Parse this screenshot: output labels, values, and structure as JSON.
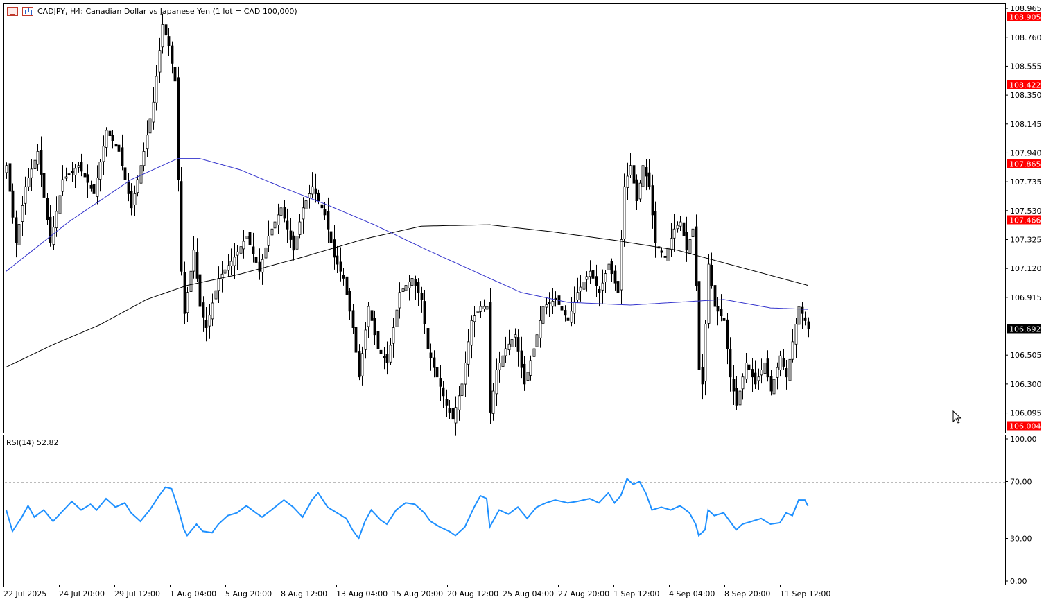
{
  "header": {
    "title": "CADJPY, H4:  Canadian Dollar vs Japanese Yen (1 lot = CAD 100,000)",
    "icons": [
      "list-icon",
      "chart-window-icon"
    ]
  },
  "rsi": {
    "label": "RSI(14) 52.82",
    "levels": [
      70,
      30
    ],
    "ticks": [
      "100.00",
      "70.00",
      "30.00",
      "0.00"
    ]
  },
  "colors": {
    "background": "#ffffff",
    "bull_candle": "#ffffff",
    "bear_candle": "#000000",
    "ma_fast": "#3333cc",
    "ma_slow": "#000000",
    "level_lines": "#ff0000",
    "current_price_line": "#000000",
    "rsi_line": "#1e90ff"
  },
  "chart_data": [
    {
      "type": "candlestick",
      "symbol": "CADJPY",
      "timeframe": "H4",
      "x_ticks": [
        "22 Jul 2025",
        "24 Jul 20:00",
        "29 Jul 12:00",
        "1 Aug 04:00",
        "5 Aug 20:00",
        "8 Aug 12:00",
        "13 Aug 04:00",
        "15 Aug 20:00",
        "20 Aug 12:00",
        "25 Aug 04:00",
        "27 Aug 20:00",
        "1 Sep 12:00",
        "4 Sep 04:00",
        "8 Sep 20:00",
        "11 Sep 12:00"
      ],
      "y_ticks": [
        "108.965",
        "108.760",
        "108.555",
        "108.350",
        "108.145",
        "107.940",
        "107.735",
        "107.530",
        "107.325",
        "107.120",
        "106.915",
        "106.505",
        "106.300",
        "106.095"
      ],
      "ylim": [
        105.96,
        108.99
      ],
      "horizontal_levels": [
        {
          "value": 108.905,
          "label": "108.905"
        },
        {
          "value": 108.422,
          "label": "108.422"
        },
        {
          "value": 107.865,
          "label": "107.865"
        },
        {
          "value": 107.466,
          "label": "107.466"
        },
        {
          "value": 106.004,
          "label": "106.004"
        }
      ],
      "current_price": {
        "value": 106.692,
        "label": "106.692"
      },
      "close_path": [
        {
          "i": 0,
          "v": 107.85
        },
        {
          "i": 3,
          "v": 107.3
        },
        {
          "i": 6,
          "v": 107.7
        },
        {
          "i": 10,
          "v": 107.95
        },
        {
          "i": 14,
          "v": 107.3
        },
        {
          "i": 18,
          "v": 107.75
        },
        {
          "i": 23,
          "v": 107.85
        },
        {
          "i": 28,
          "v": 107.65
        },
        {
          "i": 32,
          "v": 108.1
        },
        {
          "i": 36,
          "v": 107.95
        },
        {
          "i": 40,
          "v": 107.55
        },
        {
          "i": 44,
          "v": 107.95
        },
        {
          "i": 47,
          "v": 108.3
        },
        {
          "i": 50,
          "v": 108.85
        },
        {
          "i": 52,
          "v": 108.7
        },
        {
          "i": 54,
          "v": 108.45
        },
        {
          "i": 55,
          "v": 107.75
        },
        {
          "i": 56,
          "v": 107.1
        },
        {
          "i": 57,
          "v": 106.8
        },
        {
          "i": 60,
          "v": 107.25
        },
        {
          "i": 62,
          "v": 106.85
        },
        {
          "i": 64,
          "v": 106.7
        },
        {
          "i": 68,
          "v": 107.05
        },
        {
          "i": 73,
          "v": 107.2
        },
        {
          "i": 77,
          "v": 107.35
        },
        {
          "i": 81,
          "v": 107.1
        },
        {
          "i": 84,
          "v": 107.35
        },
        {
          "i": 88,
          "v": 107.55
        },
        {
          "i": 92,
          "v": 107.25
        },
        {
          "i": 95,
          "v": 107.55
        },
        {
          "i": 98,
          "v": 107.7
        },
        {
          "i": 102,
          "v": 107.5
        },
        {
          "i": 105,
          "v": 107.2
        },
        {
          "i": 108,
          "v": 107.05
        },
        {
          "i": 111,
          "v": 106.7
        },
        {
          "i": 113,
          "v": 106.35
        },
        {
          "i": 116,
          "v": 106.85
        },
        {
          "i": 119,
          "v": 106.55
        },
        {
          "i": 122,
          "v": 106.45
        },
        {
          "i": 126,
          "v": 106.95
        },
        {
          "i": 130,
          "v": 107.05
        },
        {
          "i": 133,
          "v": 106.9
        },
        {
          "i": 135,
          "v": 106.55
        },
        {
          "i": 138,
          "v": 106.35
        },
        {
          "i": 141,
          "v": 106.15
        },
        {
          "i": 143,
          "v": 106.05
        },
        {
          "i": 146,
          "v": 106.3
        },
        {
          "i": 149,
          "v": 106.75
        },
        {
          "i": 152,
          "v": 106.85
        },
        {
          "i": 154,
          "v": 106.85
        },
        {
          "i": 155,
          "v": 106.1
        },
        {
          "i": 157,
          "v": 106.4
        },
        {
          "i": 160,
          "v": 106.55
        },
        {
          "i": 163,
          "v": 106.65
        },
        {
          "i": 166,
          "v": 106.3
        },
        {
          "i": 169,
          "v": 106.55
        },
        {
          "i": 172,
          "v": 106.85
        },
        {
          "i": 176,
          "v": 106.9
        },
        {
          "i": 180,
          "v": 106.75
        },
        {
          "i": 183,
          "v": 106.95
        },
        {
          "i": 187,
          "v": 107.1
        },
        {
          "i": 190,
          "v": 106.95
        },
        {
          "i": 193,
          "v": 107.15
        },
        {
          "i": 196,
          "v": 106.95
        },
        {
          "i": 198,
          "v": 107.7
        },
        {
          "i": 200,
          "v": 107.85
        },
        {
          "i": 202,
          "v": 107.6
        },
        {
          "i": 204,
          "v": 107.85
        },
        {
          "i": 206,
          "v": 107.7
        },
        {
          "i": 208,
          "v": 107.3
        },
        {
          "i": 211,
          "v": 107.2
        },
        {
          "i": 214,
          "v": 107.4
        },
        {
          "i": 216,
          "v": 107.45
        },
        {
          "i": 218,
          "v": 107.25
        },
        {
          "i": 220,
          "v": 107.4
        },
        {
          "i": 221,
          "v": 107.0
        },
        {
          "i": 222,
          "v": 106.4
        },
        {
          "i": 223,
          "v": 106.3
        },
        {
          "i": 225,
          "v": 107.15
        },
        {
          "i": 227,
          "v": 106.85
        },
        {
          "i": 230,
          "v": 106.75
        },
        {
          "i": 232,
          "v": 106.35
        },
        {
          "i": 234,
          "v": 106.15
        },
        {
          "i": 237,
          "v": 106.45
        },
        {
          "i": 240,
          "v": 106.3
        },
        {
          "i": 243,
          "v": 106.45
        },
        {
          "i": 245,
          "v": 106.25
        },
        {
          "i": 248,
          "v": 106.5
        },
        {
          "i": 250,
          "v": 106.35
        },
        {
          "i": 252,
          "v": 106.6
        },
        {
          "i": 254,
          "v": 106.85
        },
        {
          "i": 256,
          "v": 106.75
        },
        {
          "i": 257,
          "v": 106.69
        }
      ],
      "ma_fast": [
        {
          "i": 0,
          "v": 107.1
        },
        {
          "i": 20,
          "v": 107.45
        },
        {
          "i": 40,
          "v": 107.75
        },
        {
          "i": 55,
          "v": 107.9
        },
        {
          "i": 62,
          "v": 107.9
        },
        {
          "i": 75,
          "v": 107.82
        },
        {
          "i": 88,
          "v": 107.7
        },
        {
          "i": 103,
          "v": 107.57
        },
        {
          "i": 118,
          "v": 107.43
        },
        {
          "i": 135,
          "v": 107.25
        },
        {
          "i": 150,
          "v": 107.1
        },
        {
          "i": 165,
          "v": 106.95
        },
        {
          "i": 180,
          "v": 106.88
        },
        {
          "i": 200,
          "v": 106.86
        },
        {
          "i": 215,
          "v": 106.88
        },
        {
          "i": 230,
          "v": 106.9
        },
        {
          "i": 245,
          "v": 106.84
        },
        {
          "i": 257,
          "v": 106.83
        }
      ],
      "ma_slow": [
        {
          "i": 0,
          "v": 106.42
        },
        {
          "i": 15,
          "v": 106.58
        },
        {
          "i": 30,
          "v": 106.72
        },
        {
          "i": 45,
          "v": 106.9
        },
        {
          "i": 58,
          "v": 107.0
        },
        {
          "i": 75,
          "v": 107.08
        },
        {
          "i": 95,
          "v": 107.2
        },
        {
          "i": 115,
          "v": 107.33
        },
        {
          "i": 133,
          "v": 107.42
        },
        {
          "i": 155,
          "v": 107.43
        },
        {
          "i": 175,
          "v": 107.38
        },
        {
          "i": 195,
          "v": 107.32
        },
        {
          "i": 215,
          "v": 107.25
        },
        {
          "i": 235,
          "v": 107.13
        },
        {
          "i": 257,
          "v": 107.0
        }
      ]
    },
    {
      "type": "line",
      "name": "RSI(14)",
      "ylim": [
        0,
        100
      ],
      "levels": [
        70,
        30
      ],
      "values": [
        {
          "i": 0,
          "v": 50
        },
        {
          "i": 2,
          "v": 35
        },
        {
          "i": 5,
          "v": 45
        },
        {
          "i": 7,
          "v": 53
        },
        {
          "i": 9,
          "v": 45
        },
        {
          "i": 12,
          "v": 50
        },
        {
          "i": 15,
          "v": 42
        },
        {
          "i": 18,
          "v": 49
        },
        {
          "i": 21,
          "v": 56
        },
        {
          "i": 24,
          "v": 50
        },
        {
          "i": 27,
          "v": 54
        },
        {
          "i": 29,
          "v": 50
        },
        {
          "i": 32,
          "v": 58
        },
        {
          "i": 35,
          "v": 52
        },
        {
          "i": 38,
          "v": 55
        },
        {
          "i": 40,
          "v": 48
        },
        {
          "i": 43,
          "v": 42
        },
        {
          "i": 46,
          "v": 50
        },
        {
          "i": 49,
          "v": 60
        },
        {
          "i": 51,
          "v": 66
        },
        {
          "i": 53,
          "v": 65
        },
        {
          "i": 55,
          "v": 52
        },
        {
          "i": 57,
          "v": 36
        },
        {
          "i": 58,
          "v": 32
        },
        {
          "i": 61,
          "v": 40
        },
        {
          "i": 63,
          "v": 35
        },
        {
          "i": 66,
          "v": 34
        },
        {
          "i": 68,
          "v": 40
        },
        {
          "i": 71,
          "v": 46
        },
        {
          "i": 74,
          "v": 48
        },
        {
          "i": 77,
          "v": 53
        },
        {
          "i": 80,
          "v": 48
        },
        {
          "i": 82,
          "v": 45
        },
        {
          "i": 85,
          "v": 50
        },
        {
          "i": 89,
          "v": 57
        },
        {
          "i": 92,
          "v": 52
        },
        {
          "i": 95,
          "v": 45
        },
        {
          "i": 98,
          "v": 57
        },
        {
          "i": 100,
          "v": 62
        },
        {
          "i": 103,
          "v": 52
        },
        {
          "i": 106,
          "v": 48
        },
        {
          "i": 109,
          "v": 44
        },
        {
          "i": 111,
          "v": 36
        },
        {
          "i": 113,
          "v": 30
        },
        {
          "i": 115,
          "v": 42
        },
        {
          "i": 117,
          "v": 50
        },
        {
          "i": 120,
          "v": 43
        },
        {
          "i": 122,
          "v": 40
        },
        {
          "i": 125,
          "v": 50
        },
        {
          "i": 128,
          "v": 55
        },
        {
          "i": 131,
          "v": 54
        },
        {
          "i": 134,
          "v": 48
        },
        {
          "i": 136,
          "v": 42
        },
        {
          "i": 139,
          "v": 38
        },
        {
          "i": 142,
          "v": 35
        },
        {
          "i": 144,
          "v": 32
        },
        {
          "i": 147,
          "v": 38
        },
        {
          "i": 150,
          "v": 52
        },
        {
          "i": 152,
          "v": 60
        },
        {
          "i": 154,
          "v": 58
        },
        {
          "i": 155,
          "v": 38
        },
        {
          "i": 158,
          "v": 50
        },
        {
          "i": 161,
          "v": 47
        },
        {
          "i": 164,
          "v": 52
        },
        {
          "i": 167,
          "v": 44
        },
        {
          "i": 170,
          "v": 52
        },
        {
          "i": 173,
          "v": 55
        },
        {
          "i": 176,
          "v": 57
        },
        {
          "i": 180,
          "v": 55
        },
        {
          "i": 183,
          "v": 56
        },
        {
          "i": 187,
          "v": 58
        },
        {
          "i": 190,
          "v": 55
        },
        {
          "i": 193,
          "v": 62
        },
        {
          "i": 195,
          "v": 55
        },
        {
          "i": 197,
          "v": 60
        },
        {
          "i": 199,
          "v": 72
        },
        {
          "i": 201,
          "v": 68
        },
        {
          "i": 203,
          "v": 70
        },
        {
          "i": 205,
          "v": 62
        },
        {
          "i": 207,
          "v": 50
        },
        {
          "i": 210,
          "v": 52
        },
        {
          "i": 213,
          "v": 50
        },
        {
          "i": 216,
          "v": 53
        },
        {
          "i": 219,
          "v": 48
        },
        {
          "i": 221,
          "v": 40
        },
        {
          "i": 222,
          "v": 32
        },
        {
          "i": 224,
          "v": 36
        },
        {
          "i": 225,
          "v": 50
        },
        {
          "i": 227,
          "v": 46
        },
        {
          "i": 230,
          "v": 48
        },
        {
          "i": 232,
          "v": 42
        },
        {
          "i": 234,
          "v": 36
        },
        {
          "i": 236,
          "v": 40
        },
        {
          "i": 239,
          "v": 42
        },
        {
          "i": 242,
          "v": 44
        },
        {
          "i": 245,
          "v": 40
        },
        {
          "i": 248,
          "v": 41
        },
        {
          "i": 250,
          "v": 48
        },
        {
          "i": 252,
          "v": 46
        },
        {
          "i": 254,
          "v": 57
        },
        {
          "i": 256,
          "v": 57
        },
        {
          "i": 257,
          "v": 52.82
        }
      ]
    }
  ]
}
